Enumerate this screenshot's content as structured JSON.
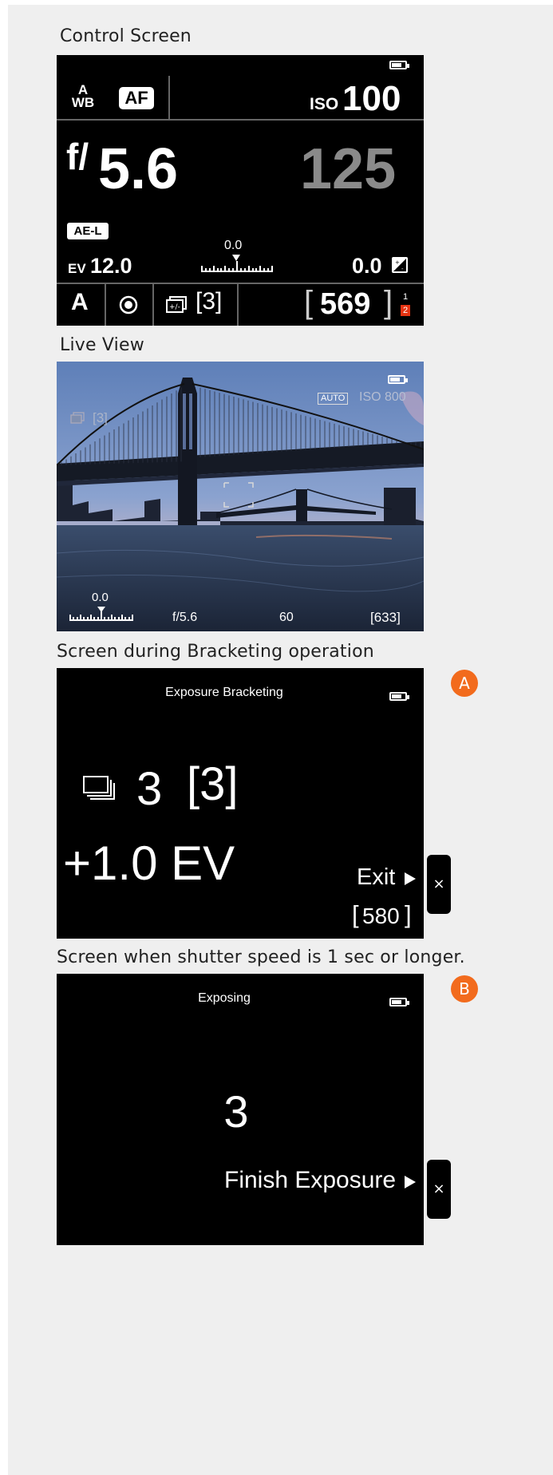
{
  "sections": {
    "control_title": "Control Screen",
    "live_title": "Live View",
    "bracketing_title": "Screen during Bracketing operation",
    "long_exposure_title": "Screen when shutter speed is 1 sec or longer."
  },
  "control": {
    "awb_top": "A",
    "awb_bottom": "WB",
    "af": "AF",
    "iso_label": "ISO",
    "iso_value": "100",
    "aperture_prefix": "f/",
    "aperture_value": "5.6",
    "shutter": "125",
    "ael": "AE-L",
    "ev_label": "EV",
    "ev_value": "12.0",
    "scale_value": "0.0",
    "comp_value": "0.0",
    "comp_icon": "exposure-comp-icon",
    "mode": "A",
    "metering_icon": "metering-icon",
    "bracket_icon": "bracketing-icon",
    "bracket_count": "[3]",
    "shots_left": "569",
    "card_top": "1",
    "card_bottom": "2"
  },
  "live": {
    "auto": "AUTO",
    "iso": "ISO 800",
    "bracket_count": "[3]",
    "scale_value": "0.0",
    "aperture": "f/5.6",
    "shutter": "60",
    "shots_left": "[633]"
  },
  "bracketing": {
    "header": "Exposure Bracketing",
    "count": "3",
    "total": "[3]",
    "ev": "+1.0 EV",
    "exit": "Exit",
    "shots_left": "580",
    "badge": "A",
    "close": "×"
  },
  "exposing": {
    "header": "Exposing",
    "countdown": "3",
    "finish": "Finish Exposure",
    "badge": "B",
    "close": "×"
  },
  "colors": {
    "accent": "#f26b1d",
    "card_red": "#e63312",
    "shutter_gray": "#8a8a8a"
  }
}
